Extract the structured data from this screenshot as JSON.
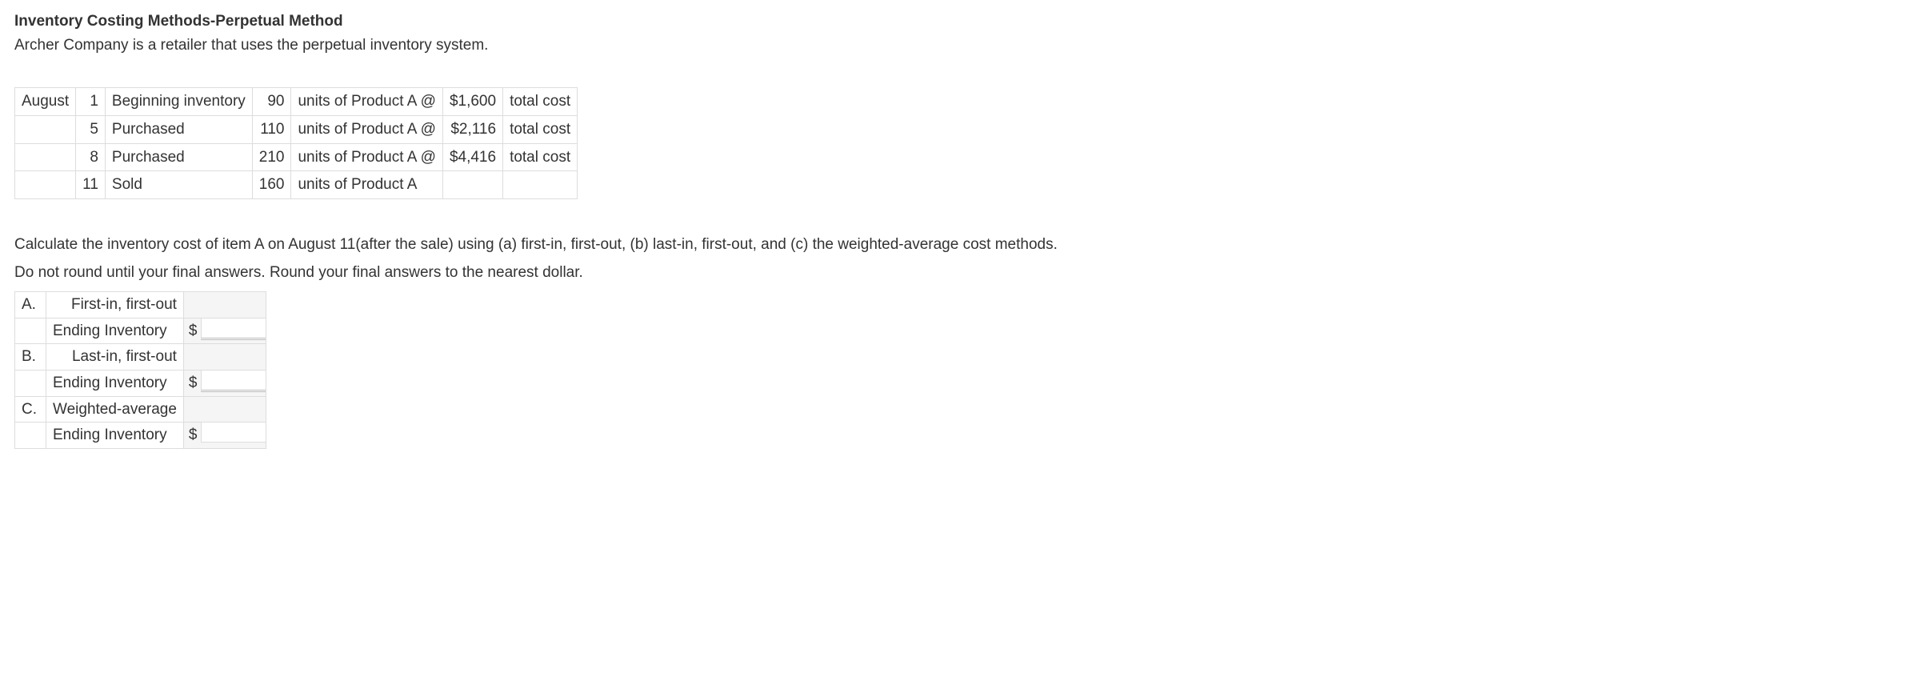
{
  "title": "Inventory Costing Methods-Perpetual Method",
  "subtitle": "Archer Company is a retailer that uses the perpetual inventory system.",
  "table": {
    "month": "August",
    "rows": [
      {
        "day": "1",
        "event": "Beginning inventory",
        "qty": "90",
        "unitsOf": "units of Product A @",
        "cost": "$1,600",
        "costLabel": "total cost"
      },
      {
        "day": "5",
        "event": "Purchased",
        "qty": "110",
        "unitsOf": "units of Product A @",
        "cost": "$2,116",
        "costLabel": "total cost"
      },
      {
        "day": "8",
        "event": "Purchased",
        "qty": "210",
        "unitsOf": "units of Product A @",
        "cost": "$4,416",
        "costLabel": "total cost"
      },
      {
        "day": "11",
        "event": "Sold",
        "qty": "160",
        "unitsOf": "units of Product A",
        "cost": "",
        "costLabel": ""
      }
    ]
  },
  "instructions": {
    "line1": "Calculate the inventory cost of item A on August 11(after the sale) using (a) first-in, first-out, (b) last-in, first-out, and (c) the weighted-average cost methods.",
    "line2": "Do not round until your final answers. Round your final answers to the nearest dollar."
  },
  "answers": {
    "a": {
      "letter": "A.",
      "method": "First-in, first-out",
      "endingLabel": "Ending Inventory",
      "dollar": "$",
      "value": ""
    },
    "b": {
      "letter": "B.",
      "method": "Last-in, first-out",
      "endingLabel": "Ending Inventory",
      "dollar": "$",
      "value": ""
    },
    "c": {
      "letter": "C.",
      "method": "Weighted-average",
      "endingLabel": "Ending Inventory",
      "dollar": "$",
      "value": ""
    }
  }
}
